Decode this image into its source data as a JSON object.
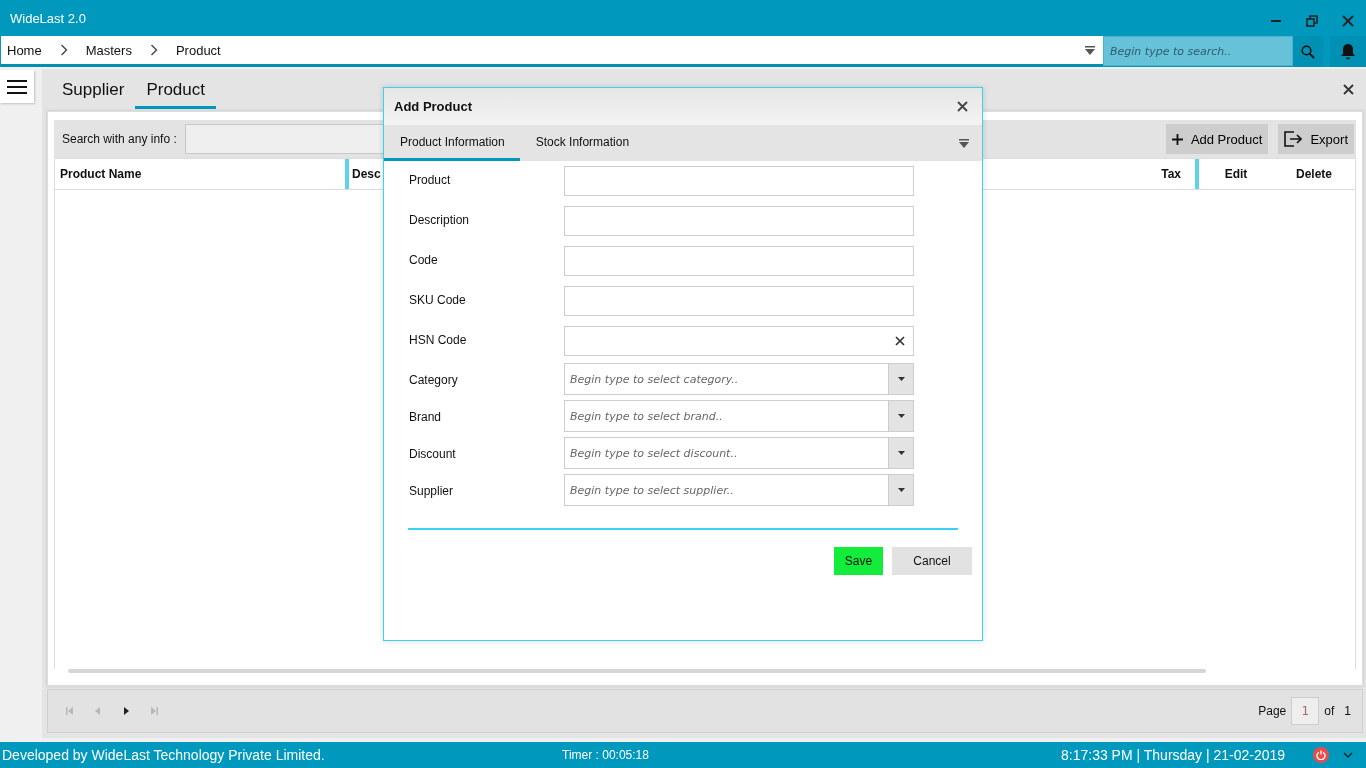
{
  "window": {
    "title": "WideLast 2.0"
  },
  "breadcrumb": [
    "Home",
    "Masters",
    "Product"
  ],
  "global_search": {
    "placeholder": "Begin type to search.."
  },
  "tabs": [
    {
      "label": "Supplier",
      "selected": false
    },
    {
      "label": "Product",
      "selected": true
    }
  ],
  "toolbar": {
    "search_label": "Search with any info :",
    "buttons": [
      {
        "label": "Add Product",
        "kind": "add"
      },
      {
        "label": "Export",
        "kind": "export"
      }
    ]
  },
  "table": {
    "columns": [
      "Product Name",
      "Desc",
      "Tax",
      "Edit",
      "Delete"
    ]
  },
  "pager": {
    "buttons": [
      {
        "kind": "first",
        "disabled": true
      },
      {
        "kind": "prev",
        "disabled": true
      },
      {
        "kind": "next",
        "disabled": false
      },
      {
        "kind": "last",
        "disabled": true
      }
    ],
    "page_label": "Page",
    "page": "1",
    "of_label": "of",
    "total": "1"
  },
  "dialog": {
    "title": "Add Product",
    "tabs": [
      {
        "label": "Product Information",
        "selected": true
      },
      {
        "label": "Stock Information",
        "selected": false
      }
    ],
    "fields": [
      {
        "label": "Product",
        "kind": "text"
      },
      {
        "label": "Description",
        "kind": "text"
      },
      {
        "label": "Code",
        "kind": "text"
      },
      {
        "label": "SKU Code",
        "kind": "text"
      },
      {
        "label": "HSN Code",
        "kind": "clearable"
      },
      {
        "label": "Category",
        "kind": "combo",
        "placeholder": "Begin type to select category.."
      },
      {
        "label": "Brand",
        "kind": "combo",
        "placeholder": "Begin type to select brand.."
      },
      {
        "label": "Discount",
        "kind": "combo",
        "placeholder": "Begin type to select discount.."
      },
      {
        "label": "Supplier",
        "kind": "combo",
        "placeholder": "Begin type to select supplier.."
      }
    ],
    "buttons": [
      {
        "label": "Save",
        "kind": "primary"
      },
      {
        "label": "Cancel",
        "kind": "secondary"
      }
    ]
  },
  "status_bar": {
    "developer": "Developed by WideLast Technology Private Limited.",
    "timer": "Timer : 00:05:18",
    "datetime": "8:17:33 PM | Thursday | 21-02-2019"
  }
}
